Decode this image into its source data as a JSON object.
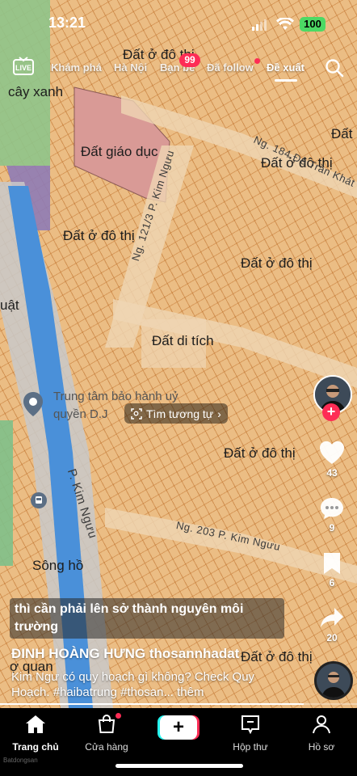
{
  "status": {
    "time": "13:21",
    "battery": "100"
  },
  "tabs": {
    "live": "LIVE",
    "explore": "Khám phá",
    "location": "Hà Nội",
    "friends": "Bạn bè",
    "friends_badge": "99",
    "following": "Đã follow",
    "for_you": "Đề xuất"
  },
  "map": {
    "labels": {
      "green": "cây xanh",
      "education": "Đất giáo dục",
      "urban_top_center": "Đất ở đô thị",
      "urban_right_top": "Đất",
      "urban_right_2": "Đất ở đô thị",
      "urban_left_mid": "Đất ở đô thị",
      "urban_center": "Đất ở đô thị",
      "left_cut": "uật",
      "heritage": "Đất di tích",
      "urban_lower": "Đất ở đô thị",
      "river": "Sông hồ",
      "left_bottom": "ợ quan",
      "urban_bottom": "Đất ở đô thị"
    },
    "roads": {
      "ng184": "Ng. 184 Đê Trần Khát",
      "ng121": "Ng. 121/3 P. Kim Ngưu",
      "p_kim_nguu": "P. Kim Ngưu",
      "ng203": "Ng. 203 P. Kim Ngưu"
    },
    "poi": {
      "name_line1": "Trung tâm bảo hành uỷ",
      "name_line2": "quyền D.J"
    }
  },
  "search_chip": "Tìm tương tự",
  "actions": {
    "likes": "43",
    "comments": "9",
    "saves": "6",
    "shares": "20"
  },
  "caption": {
    "overlay": "thì cần phải lên sở thành nguyên môi trường",
    "author": "ĐINH HOÀNG HƯNG thosannhadat",
    "description": "Kim Ngư có quy hoạch gì không? Check Quy Hoạch. #haibatrung #thosan... thêm"
  },
  "nav": {
    "home": "Trang chủ",
    "shop": "Cửa hàng",
    "inbox": "Hộp thư",
    "profile": "Hồ sơ"
  },
  "watermark": "Batdongsan",
  "colors": {
    "accent": "#fe2c55",
    "map_orange": "#ebbd84",
    "education": "#d99a96",
    "river": "#4a90d9",
    "green": "#7bc47f"
  }
}
